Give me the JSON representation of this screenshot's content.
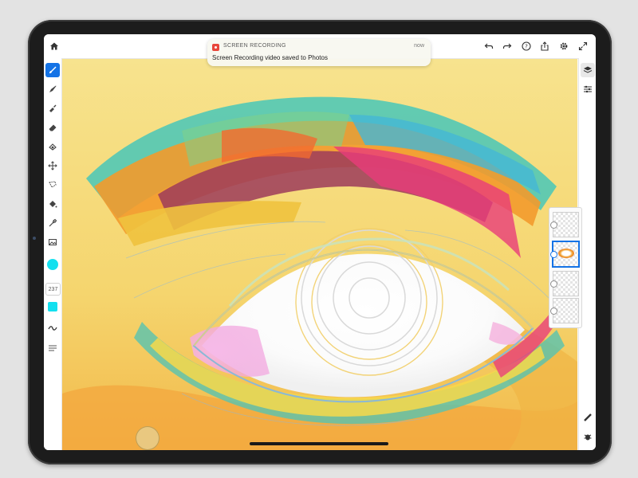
{
  "topbar": {
    "home_icon": "home-icon",
    "actions": [
      "undo-icon",
      "redo-icon",
      "help-icon",
      "share-icon",
      "settings-icon",
      "fullscreen-icon"
    ]
  },
  "left_toolbar": {
    "tools": [
      "brush-icon",
      "smudge-icon",
      "fill-brush-icon",
      "eraser-icon",
      "blend-icon",
      "transform-icon",
      "lasso-icon",
      "fill-bucket-icon",
      "eyedropper-icon",
      "image-icon"
    ],
    "active_tool": "brush-icon",
    "color": "#14e0ef",
    "brush_size": "237"
  },
  "right_toolbar": {
    "tools": [
      "layers-icon",
      "properties-icon"
    ],
    "bottom_tools": [
      "ruler-icon",
      "bug-icon"
    ]
  },
  "layers_panel": {
    "layer_count": 4,
    "active_layer_index": 1,
    "actions": [
      "add-layer-icon",
      "visibility-icon",
      "layer-import-icon",
      "more-icon"
    ]
  },
  "notification": {
    "app": "SCREEN RECORDING",
    "time": "now",
    "message": "Screen Recording video saved to Photos"
  },
  "colors": {
    "accent": "#1473e6",
    "brush_color": "#14e0ef"
  }
}
